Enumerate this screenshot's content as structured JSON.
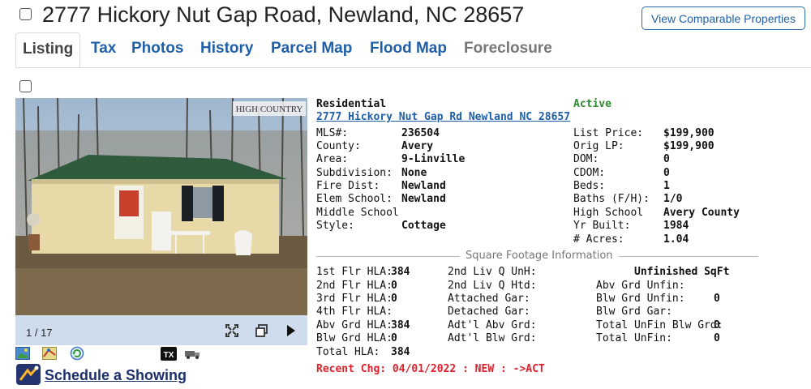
{
  "header": {
    "address": "2777 Hickory Nut Gap Road, Newland, NC 28657",
    "comparable_button": "View Comparable Properties"
  },
  "tabs": [
    {
      "label": "Listing",
      "state": "active"
    },
    {
      "label": "Tax",
      "state": "link"
    },
    {
      "label": "Photos",
      "state": "link"
    },
    {
      "label": "History",
      "state": "link"
    },
    {
      "label": "Parcel Map",
      "state": "link"
    },
    {
      "label": "Flood Map",
      "state": "link"
    },
    {
      "label": "Foreclosure",
      "state": "disabled"
    }
  ],
  "photo": {
    "watermark": "HIGH COUNTRY",
    "counter": "1 / 17"
  },
  "schedule_label": "Schedule a Showing",
  "listing": {
    "type": "Residential",
    "status": "Active",
    "address_link": "2777 Hickory Nut Gap Rd Newland NC 28657",
    "left_fields": [
      {
        "label": "MLS#:",
        "value": "236504"
      },
      {
        "label": "County:",
        "value": "Avery"
      },
      {
        "label": "Area:",
        "value": "9-Linville"
      },
      {
        "label": "Subdivision:",
        "value": "None"
      },
      {
        "label": "Fire Dist:",
        "value": "Newland"
      },
      {
        "label": "Elem School:",
        "value": "Newland"
      },
      {
        "label": "Middle School",
        "value": ""
      },
      {
        "label": "Style:",
        "value": "Cottage"
      }
    ],
    "right_fields": [
      {
        "label": "List Price:",
        "value": "$199,900"
      },
      {
        "label": "Orig LP:",
        "value": "$199,900"
      },
      {
        "label": "DOM:",
        "value": "0"
      },
      {
        "label": "CDOM:",
        "value": "0"
      },
      {
        "label": "Beds:",
        "value": "1"
      },
      {
        "label": "Baths (F/H):",
        "value": "1/0"
      },
      {
        "label": "High School",
        "value": "Avery County"
      },
      {
        "label": "Yr Built:",
        "value": "1984"
      },
      {
        "label": "# Acres:",
        "value": "1.04"
      }
    ],
    "sqft_heading": "Square Footage Information",
    "sqft_col1": [
      {
        "label": "1st Flr HLA:",
        "value": "384"
      },
      {
        "label": "2nd Flr HLA:",
        "value": "0"
      },
      {
        "label": "3rd Flr HLA:",
        "value": "0"
      },
      {
        "label": "4th Flr HLA:",
        "value": ""
      },
      {
        "label": "Abv Grd HLA:",
        "value": "384"
      },
      {
        "label": "Blw Grd HLA:",
        "value": "0"
      },
      {
        "label": "Total HLA:",
        "value": "384"
      }
    ],
    "sqft_col2": [
      {
        "label": "2nd Liv Q UnH:"
      },
      {
        "label": "2nd Liv Q Htd:"
      },
      {
        "label": "Attached Gar:"
      },
      {
        "label": "Detached Gar:"
      },
      {
        "label": "Adt'l Abv Grd:"
      },
      {
        "label": "Adt'l Blw Grd:"
      }
    ],
    "unfinished_heading": "Unfinished SqFt",
    "sqft_col3": [
      {
        "label": "Abv Grd Unfin:",
        "value": ""
      },
      {
        "label": "Blw Grd Unfin:",
        "value": "0"
      },
      {
        "label": "Blw Grd Gar:",
        "value": ""
      },
      {
        "label": "Total UnFin Blw Grd:",
        "value": "0"
      },
      {
        "label": "Total UnFin:",
        "value": "0"
      }
    ],
    "recent_change": "Recent Chg: 04/01/2022 : NEW : ->ACT"
  },
  "colors": {
    "link": "#1f5fa8",
    "status_active": "#2e8b2e",
    "recent_change": "#e0202a"
  }
}
